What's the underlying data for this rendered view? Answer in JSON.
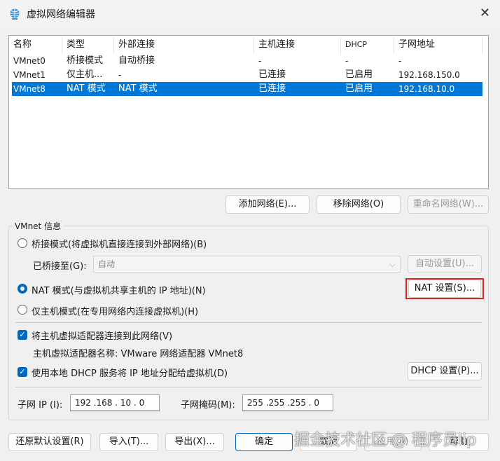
{
  "window": {
    "title": "虚拟网络编辑器",
    "close": "✕"
  },
  "table": {
    "headers": [
      "名称",
      "类型",
      "外部连接",
      "主机连接",
      "DHCP",
      "子网地址"
    ],
    "rows": [
      [
        "VMnet0",
        "桥接模式",
        "自动桥接",
        "-",
        "-",
        "-"
      ],
      [
        "VMnet1",
        "仅主机...",
        "-",
        "已连接",
        "已启用",
        "192.168.150.0"
      ],
      [
        "VMnet8",
        "NAT 模式",
        "NAT 模式",
        "已连接",
        "已启用",
        "192.168.10.0"
      ]
    ],
    "selected_index": 2
  },
  "list_buttons": {
    "add": "添加网络(E)...",
    "remove": "移除网络(O)",
    "rename": "重命名网络(W)..."
  },
  "info": {
    "group_label": "VMnet 信息",
    "bridge_radio": "桥接模式(将虚拟机直接连接到外部网络)(B)",
    "bridged_to_label": "已桥接至(G):",
    "bridged_to_value": "自动",
    "auto_settings": "自动设置(U)...",
    "nat_radio": "NAT 模式(与虚拟机共享主机的 IP 地址)(N)",
    "nat_settings": "NAT 设置(S)...",
    "host_only_radio": "仅主机模式(在专用网络内连接虚拟机)(H)",
    "connect_adapter": "将主机虚拟适配器连接到此网络(V)",
    "adapter_name": "主机虚拟适配器名称: VMware 网络适配器 VMnet8",
    "use_dhcp": "使用本地 DHCP 服务将 IP 地址分配给虚拟机(D)",
    "dhcp_settings": "DHCP 设置(P)...",
    "subnet_ip_label": "子网 IP (I):",
    "subnet_ip": "192 .168 . 10 . 0",
    "subnet_mask_label": "子网掩码(M):",
    "subnet_mask": "255 .255 .255 . 0"
  },
  "footer": {
    "restore": "还原默认设置(R)",
    "import": "导入(T)...",
    "export": "导出(X)...",
    "ok": "确定",
    "cancel": "取消",
    "apply": "应用(A)",
    "help": "帮助"
  },
  "watermark": "掘金技术社区 @ 程序员lip",
  "colors": {
    "accent": "#0067c0",
    "selection": "#0078d7",
    "highlight_border": "#d9262b"
  }
}
